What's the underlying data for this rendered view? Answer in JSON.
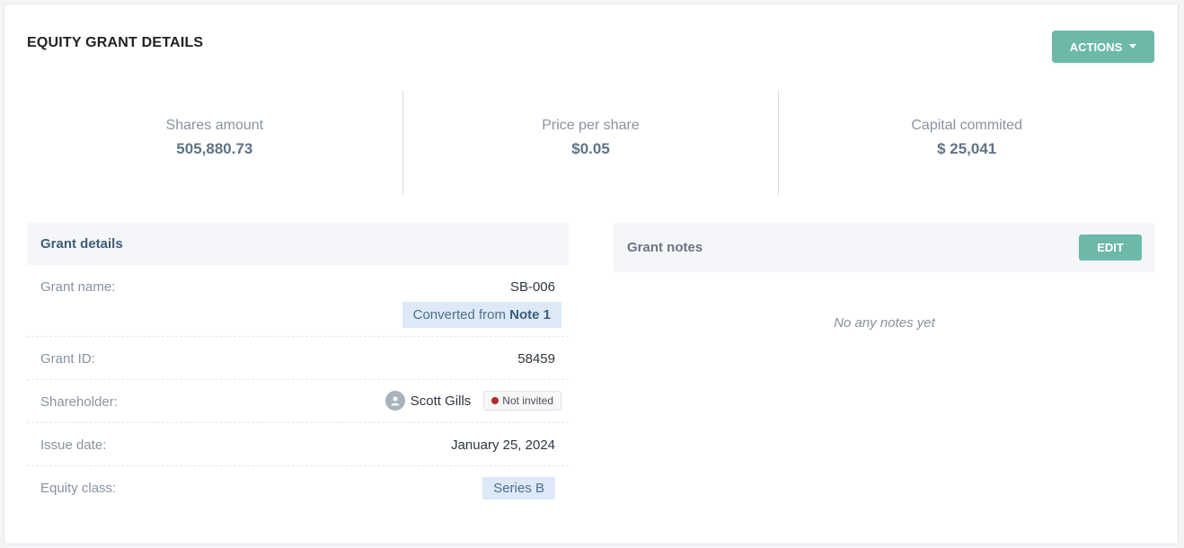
{
  "header": {
    "title": "EQUITY GRANT DETAILS",
    "actions_label": "ACTIONS"
  },
  "stats": [
    {
      "label": "Shares amount",
      "value": "505,880.73"
    },
    {
      "label": "Price per share",
      "value": "$0.05"
    },
    {
      "label": "Capital commited",
      "value": "$ 25,041"
    }
  ],
  "grant_details": {
    "title": "Grant details",
    "grant_name_label": "Grant name:",
    "grant_name_value": "SB-006",
    "converted_prefix": "Converted from",
    "converted_note": "Note 1",
    "grant_id_label": "Grant ID:",
    "grant_id_value": "58459",
    "shareholder_label": "Shareholder:",
    "shareholder_name": "Scott Gills",
    "shareholder_status": "Not invited",
    "issue_date_label": "Issue date:",
    "issue_date_value": "January 25, 2024",
    "equity_class_label": "Equity class:",
    "equity_class_value": "Series B"
  },
  "grant_notes": {
    "title": "Grant notes",
    "edit_label": "EDIT",
    "empty_text": "No any notes yet"
  },
  "colors": {
    "accent": "#6cb9a9",
    "status_dot": "#b42828",
    "badge_bg": "#dde9f6"
  }
}
